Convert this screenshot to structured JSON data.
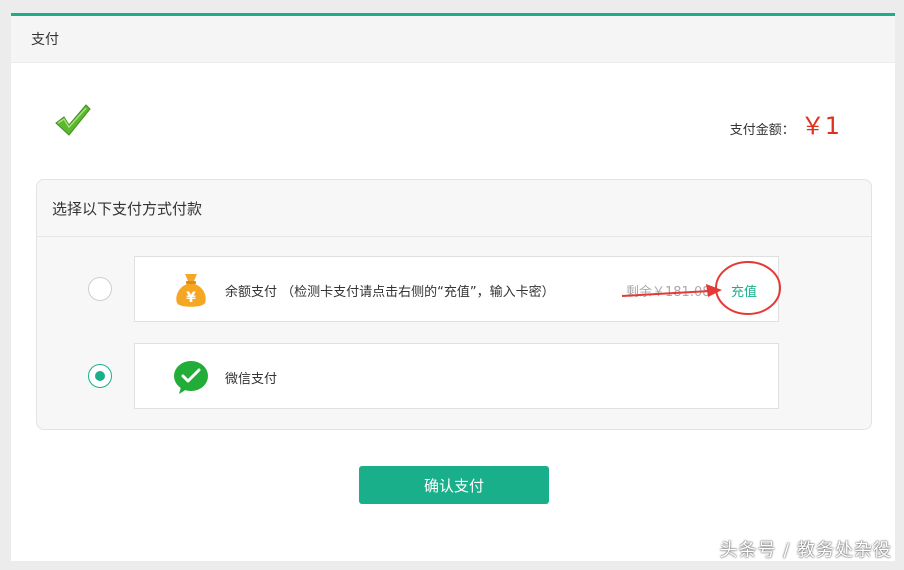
{
  "header": {
    "title": "支付"
  },
  "amount": {
    "label": "支付金额：",
    "value": "￥1"
  },
  "methods": {
    "title": "选择以下支付方式付款",
    "options": [
      {
        "icon": "money-bag-icon",
        "label": "余额支付 （检测卡支付请点击右侧的“充值”，输入卡密）",
        "remain": "剩余￥181.08",
        "action": "充值",
        "selected": false
      },
      {
        "icon": "wechat-pay-icon",
        "label": "微信支付",
        "selected": true
      }
    ]
  },
  "confirm_button": "确认支付",
  "watermark": "头条号 / 教务处杂役",
  "colors": {
    "accent": "#1aaf8b",
    "amount": "#e0301e",
    "annotation": "#e53935"
  }
}
